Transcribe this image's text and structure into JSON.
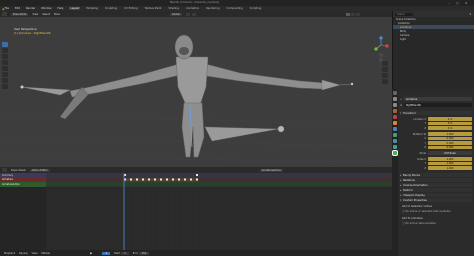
{
  "window": {
    "title": "Blender [C:\\Users\\...\\character_rig.blend]"
  },
  "menu": {
    "items": [
      "File",
      "Edit",
      "Render",
      "Window",
      "Help"
    ],
    "workspaces": [
      "Layout",
      "Modeling",
      "Sculpting",
      "UV Editing",
      "Texture Paint",
      "Shading",
      "Animation",
      "Rendering",
      "Compositing",
      "Scripting"
    ],
    "active_workspace": "Layout"
  },
  "viewport": {
    "mode": "Pose Mode",
    "menus": [
      "View",
      "Select",
      "Pose"
    ],
    "transform_orientation": "Global",
    "info_line1": "User Perspective",
    "info_line2": "(1) Armature : RightHandIK"
  },
  "outliner": {
    "search_placeholder": "Search",
    "rows": [
      "Scene Collection",
      "Collection",
      "Armature",
      "Body",
      "Camera",
      "Light"
    ],
    "selected_row": "Armature"
  },
  "properties": {
    "object_name": "Armature",
    "bone_name": "RightHandIK",
    "transform_section": "Transform",
    "location_label": "Location X",
    "location_y_label": "Y",
    "location_z_label": "Z",
    "location": [
      "0 m",
      "0 m",
      "0 m"
    ],
    "rotation_label": "Rotation W",
    "rotation_x_label": "X",
    "rotation_y_label": "Y",
    "rotation_z_label": "Z",
    "rotation": [
      "1.000",
      "0.000",
      "0.000",
      "0.000"
    ],
    "mode_label": "Mode",
    "mode_value": "XYZ Euler",
    "scale_label": "Scale X",
    "scale_y_label": "Y",
    "scale_z_label": "Z",
    "scale": [
      "1.000",
      "1.000",
      "1.000"
    ],
    "sections": [
      "Bendy Bones",
      "Relations",
      "Inverse Kinematics",
      "Deform",
      "Viewport Display",
      "Custom Properties"
    ],
    "sub1": "Add to Selected / Active",
    "sub2": "No active or selected data available",
    "sub3": "Add To Armature",
    "sub4": "No active data available"
  },
  "timeline": {
    "editor": "Dope Sheet",
    "mode": "Action Editor",
    "action_name": "ArmatureAction",
    "channels": [
      "Summary",
      "Armature",
      "ArmatureAction"
    ],
    "footer_items": [
      "Playback",
      "Keying",
      "View",
      "Marker"
    ],
    "current_frame": 1,
    "start_label": "Start",
    "start": 1,
    "end_label": "End",
    "end": 250,
    "frame_ticks": [
      0,
      20,
      40,
      60,
      80,
      100,
      120,
      140,
      160,
      180,
      200,
      220,
      240
    ]
  }
}
